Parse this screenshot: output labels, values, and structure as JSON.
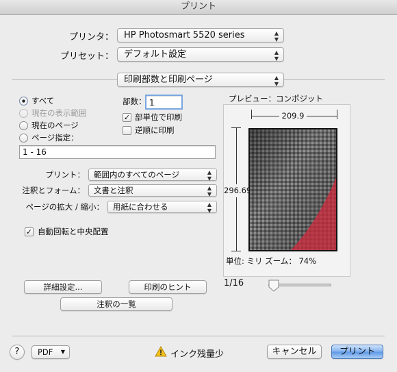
{
  "window": {
    "title": "プリント"
  },
  "printer": {
    "label": "プリンタ：",
    "value": "HP Photosmart 5520 series"
  },
  "preset": {
    "label": "プリセット：",
    "value": "デフォルト設定"
  },
  "section": {
    "value": "印刷部数と印刷ページ"
  },
  "pages": {
    "all": "すべて",
    "current_range": "現在の表示範囲",
    "current_page": "現在のページ",
    "page_spec": "ページ指定：",
    "range_value": "1 - 16"
  },
  "copies": {
    "label": "部数：",
    "value": "1",
    "collate": "部単位で印刷",
    "reverse": "逆順に印刷"
  },
  "options": {
    "print_label": "プリント：",
    "print_value": "範囲内のすべてのページ",
    "annot_label": "注釈とフォーム：",
    "annot_value": "文書と注釈",
    "scale_label": "ページの拡大 / 縮小：",
    "scale_value": "用紙に合わせる",
    "auto_rotate": "自動回転と中央配置"
  },
  "preview": {
    "title": "プレビュー：コンポジット",
    "width": "209.9",
    "height": "296.69",
    "unit_zoom": "単位: ミリ ズーム： 74%",
    "page_counter": "1/16",
    "page_fraction": 0.0
  },
  "buttons": {
    "details": "詳細設定...",
    "hints": "印刷のヒント",
    "annotations": "注釈の一覧",
    "help": "?",
    "pdf": "PDF",
    "cancel": "キャンセル",
    "print": "プリント"
  },
  "status": {
    "text": "インク残量少"
  },
  "icons": {
    "radio_selected": "radio-selected-icon",
    "checkbox_checked": "checkbox-check-icon",
    "warning": "warning-triangle-icon",
    "popup_arrows": "updown-arrows-icon"
  },
  "colors": {
    "accent": "#5e97e4",
    "warning": "#f2c21b"
  }
}
